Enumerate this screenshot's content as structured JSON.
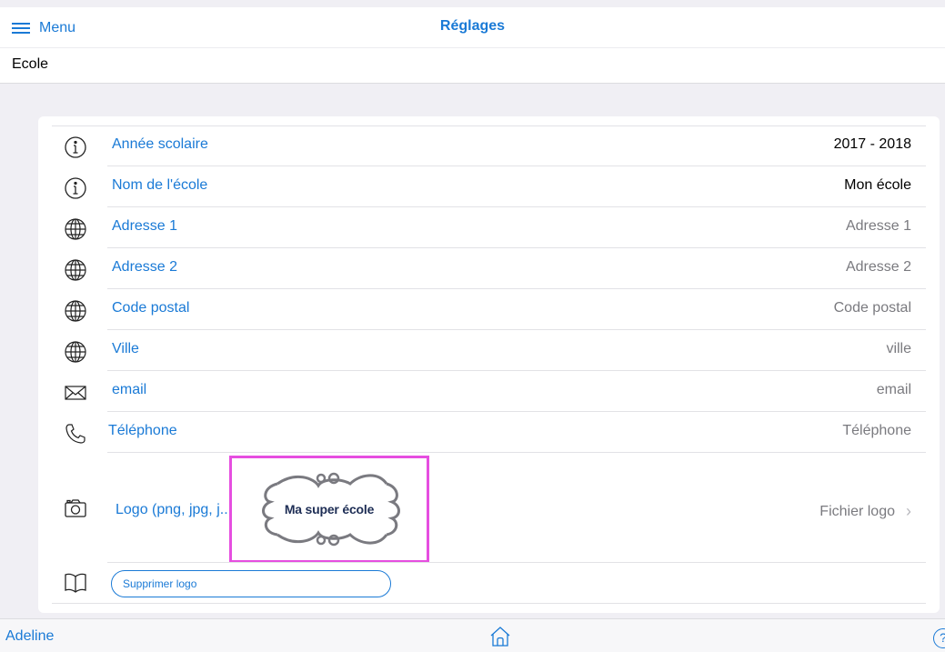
{
  "header": {
    "menu_label": "Menu",
    "title": "Réglages",
    "section": "Ecole"
  },
  "settings": {
    "rows": [
      {
        "icon": "info-icon",
        "label": "Année scolaire",
        "value": "2017 - 2018",
        "filled": true
      },
      {
        "icon": "info-icon",
        "label": "Nom de l'école",
        "value": "Mon école",
        "filled": true
      },
      {
        "icon": "globe-icon",
        "label": "Adresse 1",
        "value": "Adresse 1",
        "filled": false
      },
      {
        "icon": "globe-icon",
        "label": "Adresse 2",
        "value": "Adresse 2",
        "filled": false
      },
      {
        "icon": "globe-icon",
        "label": "Code postal",
        "value": "Code postal",
        "filled": false
      },
      {
        "icon": "globe-icon",
        "label": "Ville",
        "value": "ville",
        "filled": false
      },
      {
        "icon": "envelope-icon",
        "label": "email",
        "value": "email",
        "filled": false
      },
      {
        "icon": "phone-icon",
        "label": "Téléphone",
        "value": "Téléphone",
        "filled": false
      }
    ],
    "logo": {
      "label": "Logo (png, jpg, j...",
      "preview_text": "Ma super école",
      "file_link": "Fichier logo"
    },
    "delete_logo_label": "Supprimer logo"
  },
  "footer": {
    "user": "Adeline",
    "help": "?"
  },
  "colors": {
    "accent": "#1a7ad6",
    "highlight": "#e64ee0"
  }
}
